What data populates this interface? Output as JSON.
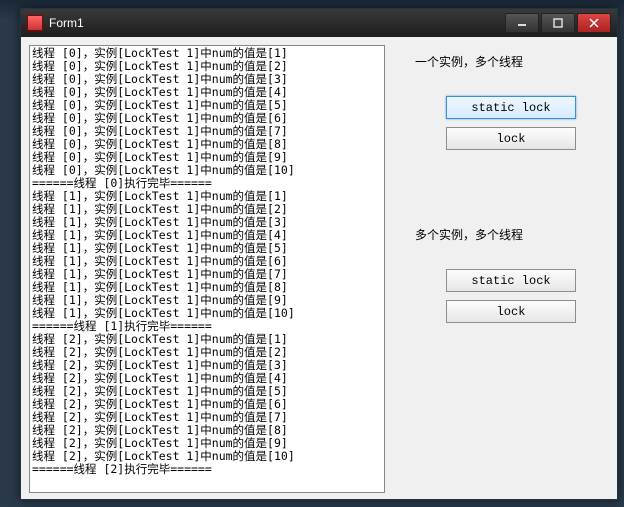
{
  "window": {
    "title": "Form1"
  },
  "output": {
    "threads": [
      0,
      1,
      2
    ],
    "instance": "LockTest 1",
    "thread_word": "线程",
    "instance_word": "实例",
    "num_word": "中num的值是",
    "done_word": "执行完毕",
    "sep": "======",
    "values": [
      1,
      2,
      3,
      4,
      5,
      6,
      7,
      8,
      9,
      10
    ]
  },
  "panel": {
    "section1": {
      "label": "一个实例，多个线程",
      "btn_static": "static lock",
      "btn_lock": "lock"
    },
    "section2": {
      "label": "多个实例，多个线程",
      "btn_static": "static lock",
      "btn_lock": "lock"
    }
  }
}
